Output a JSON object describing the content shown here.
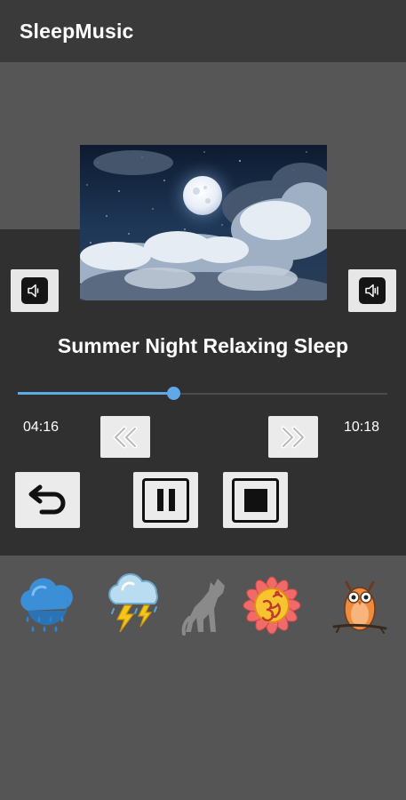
{
  "app": {
    "title": "SleepMusic"
  },
  "player": {
    "track_title": "Summer Night Relaxing Sleep",
    "elapsed": "04:16",
    "duration": "10:18",
    "progress": 0.42
  },
  "controls": {
    "volume_down_icon": "volume-down-icon",
    "volume_up_icon": "volume-up-icon",
    "rewind_icon": "rewind-icon",
    "fast_forward_icon": "fast-forward-icon",
    "repeat_icon": "repeat-icon",
    "pause_icon": "pause-icon",
    "stop_icon": "stop-icon"
  },
  "sounds": [
    {
      "icon": "rain-cloud-icon"
    },
    {
      "icon": "thunderstorm-icon"
    },
    {
      "icon": "howling-wolf-icon"
    },
    {
      "icon": "om-lotus-icon"
    },
    {
      "icon": "owl-icon"
    }
  ],
  "colors": {
    "accent": "#5fa9e6",
    "appbar": "#3a3a3a",
    "panel": "#303030",
    "background": "#555555"
  }
}
